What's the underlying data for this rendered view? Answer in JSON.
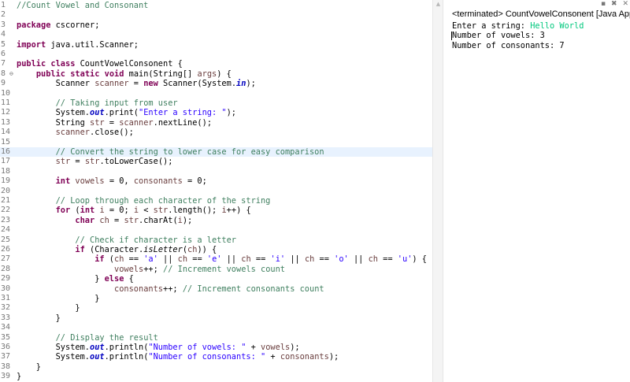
{
  "editor": {
    "lines": [
      {
        "n": "1",
        "tokens": [
          [
            "c",
            "//Count Vowel and Consonant"
          ]
        ]
      },
      {
        "n": "2",
        "tokens": []
      },
      {
        "n": "3",
        "tokens": [
          [
            "k",
            "package"
          ],
          [
            "p",
            " cscorner;"
          ]
        ]
      },
      {
        "n": "4",
        "tokens": []
      },
      {
        "n": "5",
        "tokens": [
          [
            "k",
            "import"
          ],
          [
            "p",
            " java.util.Scanner;"
          ]
        ]
      },
      {
        "n": "6",
        "tokens": []
      },
      {
        "n": "7",
        "tokens": [
          [
            "k",
            "public"
          ],
          [
            "p",
            " "
          ],
          [
            "k",
            "class"
          ],
          [
            "p",
            " CountVowelConsonent {"
          ]
        ]
      },
      {
        "n": "8",
        "fold": true,
        "tokens": [
          [
            "p",
            "    "
          ],
          [
            "k",
            "public"
          ],
          [
            "p",
            " "
          ],
          [
            "k",
            "static"
          ],
          [
            "p",
            " "
          ],
          [
            "k",
            "void"
          ],
          [
            "p",
            " main(String[] "
          ],
          [
            "v",
            "args"
          ],
          [
            "p",
            ") {"
          ]
        ]
      },
      {
        "n": "9",
        "tokens": [
          [
            "p",
            "        Scanner "
          ],
          [
            "v",
            "scanner"
          ],
          [
            "p",
            " = "
          ],
          [
            "k",
            "new"
          ],
          [
            "p",
            " Scanner(System."
          ],
          [
            "f",
            "in"
          ],
          [
            "p",
            ");"
          ]
        ]
      },
      {
        "n": "10",
        "tokens": []
      },
      {
        "n": "11",
        "tokens": [
          [
            "p",
            "        "
          ],
          [
            "c",
            "// Taking input from user"
          ]
        ]
      },
      {
        "n": "12",
        "tokens": [
          [
            "p",
            "        System."
          ],
          [
            "f",
            "out"
          ],
          [
            "p",
            ".print("
          ],
          [
            "s",
            "\"Enter a string: \""
          ],
          [
            "p",
            ");"
          ]
        ]
      },
      {
        "n": "13",
        "tokens": [
          [
            "p",
            "        String "
          ],
          [
            "v",
            "str"
          ],
          [
            "p",
            " = "
          ],
          [
            "v",
            "scanner"
          ],
          [
            "p",
            ".nextLine();"
          ]
        ]
      },
      {
        "n": "14",
        "tokens": [
          [
            "p",
            "        "
          ],
          [
            "v",
            "scanner"
          ],
          [
            "p",
            ".close();"
          ]
        ]
      },
      {
        "n": "15",
        "tokens": []
      },
      {
        "n": "16",
        "hl": true,
        "tokens": [
          [
            "p",
            "        "
          ],
          [
            "c",
            "// Convert the string to lower case for easy comparison"
          ]
        ]
      },
      {
        "n": "17",
        "tokens": [
          [
            "p",
            "        "
          ],
          [
            "v",
            "str"
          ],
          [
            "p",
            " = "
          ],
          [
            "v",
            "str"
          ],
          [
            "p",
            ".toLowerCase();"
          ]
        ]
      },
      {
        "n": "18",
        "tokens": []
      },
      {
        "n": "19",
        "tokens": [
          [
            "p",
            "        "
          ],
          [
            "k",
            "int"
          ],
          [
            "p",
            " "
          ],
          [
            "v",
            "vowels"
          ],
          [
            "p",
            " = 0, "
          ],
          [
            "v",
            "consonants"
          ],
          [
            "p",
            " = 0;"
          ]
        ]
      },
      {
        "n": "20",
        "tokens": []
      },
      {
        "n": "21",
        "tokens": [
          [
            "p",
            "        "
          ],
          [
            "c",
            "// Loop through each character of the string"
          ]
        ]
      },
      {
        "n": "22",
        "tokens": [
          [
            "p",
            "        "
          ],
          [
            "k",
            "for"
          ],
          [
            "p",
            " ("
          ],
          [
            "k",
            "int"
          ],
          [
            "p",
            " "
          ],
          [
            "v",
            "i"
          ],
          [
            "p",
            " = 0; "
          ],
          [
            "v",
            "i"
          ],
          [
            "p",
            " < "
          ],
          [
            "v",
            "str"
          ],
          [
            "p",
            ".length(); "
          ],
          [
            "v",
            "i"
          ],
          [
            "p",
            "++) {"
          ]
        ]
      },
      {
        "n": "23",
        "tokens": [
          [
            "p",
            "            "
          ],
          [
            "k",
            "char"
          ],
          [
            "p",
            " "
          ],
          [
            "v",
            "ch"
          ],
          [
            "p",
            " = "
          ],
          [
            "v",
            "str"
          ],
          [
            "p",
            ".charAt("
          ],
          [
            "v",
            "i"
          ],
          [
            "p",
            ");"
          ]
        ]
      },
      {
        "n": "24",
        "tokens": []
      },
      {
        "n": "25",
        "tokens": [
          [
            "p",
            "            "
          ],
          [
            "c",
            "// Check if character is a letter"
          ]
        ]
      },
      {
        "n": "26",
        "tokens": [
          [
            "p",
            "            "
          ],
          [
            "k",
            "if"
          ],
          [
            "p",
            " (Character."
          ],
          [
            "i",
            "isLetter"
          ],
          [
            "p",
            "("
          ],
          [
            "v",
            "ch"
          ],
          [
            "p",
            ")) {"
          ]
        ]
      },
      {
        "n": "27",
        "tokens": [
          [
            "p",
            "                "
          ],
          [
            "k",
            "if"
          ],
          [
            "p",
            " ("
          ],
          [
            "v",
            "ch"
          ],
          [
            "p",
            " == "
          ],
          [
            "s",
            "'a'"
          ],
          [
            "p",
            " || "
          ],
          [
            "v",
            "ch"
          ],
          [
            "p",
            " == "
          ],
          [
            "s",
            "'e'"
          ],
          [
            "p",
            " || "
          ],
          [
            "v",
            "ch"
          ],
          [
            "p",
            " == "
          ],
          [
            "s",
            "'i'"
          ],
          [
            "p",
            " || "
          ],
          [
            "v",
            "ch"
          ],
          [
            "p",
            " == "
          ],
          [
            "s",
            "'o'"
          ],
          [
            "p",
            " || "
          ],
          [
            "v",
            "ch"
          ],
          [
            "p",
            " == "
          ],
          [
            "s",
            "'u'"
          ],
          [
            "p",
            ") {"
          ]
        ]
      },
      {
        "n": "28",
        "tokens": [
          [
            "p",
            "                    "
          ],
          [
            "v",
            "vowels"
          ],
          [
            "p",
            "++; "
          ],
          [
            "c",
            "// Increment vowels count"
          ]
        ]
      },
      {
        "n": "29",
        "tokens": [
          [
            "p",
            "                } "
          ],
          [
            "k",
            "else"
          ],
          [
            "p",
            " {"
          ]
        ]
      },
      {
        "n": "30",
        "tokens": [
          [
            "p",
            "                    "
          ],
          [
            "v",
            "consonants"
          ],
          [
            "p",
            "++; "
          ],
          [
            "c",
            "// Increment consonants count"
          ]
        ]
      },
      {
        "n": "31",
        "tokens": [
          [
            "p",
            "                }"
          ]
        ]
      },
      {
        "n": "32",
        "tokens": [
          [
            "p",
            "            }"
          ]
        ]
      },
      {
        "n": "33",
        "tokens": [
          [
            "p",
            "        }"
          ]
        ]
      },
      {
        "n": "34",
        "tokens": []
      },
      {
        "n": "35",
        "tokens": [
          [
            "p",
            "        "
          ],
          [
            "c",
            "// Display the result"
          ]
        ]
      },
      {
        "n": "36",
        "tokens": [
          [
            "p",
            "        System."
          ],
          [
            "f",
            "out"
          ],
          [
            "p",
            ".println("
          ],
          [
            "s",
            "\"Number of vowels: \""
          ],
          [
            "p",
            " + "
          ],
          [
            "v",
            "vowels"
          ],
          [
            "p",
            ");"
          ]
        ]
      },
      {
        "n": "37",
        "tokens": [
          [
            "p",
            "        System."
          ],
          [
            "f",
            "out"
          ],
          [
            "p",
            ".println("
          ],
          [
            "s",
            "\"Number of consonants: \""
          ],
          [
            "p",
            " + "
          ],
          [
            "v",
            "consonants"
          ],
          [
            "p",
            ");"
          ]
        ]
      },
      {
        "n": "38",
        "tokens": [
          [
            "p",
            "    }"
          ]
        ]
      },
      {
        "n": "39",
        "tokens": [
          [
            "p",
            "}"
          ]
        ]
      }
    ]
  },
  "console": {
    "title": "<terminated> CountVowelConsonent [Java App",
    "lines": [
      {
        "out": "Enter a string: ",
        "in": "Hello World"
      },
      {
        "out": "Number of vowels: 3",
        "in": ""
      },
      {
        "out": "Number of consonants: 7",
        "in": ""
      }
    ],
    "toolbar_icons": [
      "minimize-icon",
      "remove-all-icon",
      "close-icon"
    ]
  },
  "colors": {
    "keyword": "#7f0055",
    "comment": "#3f7f5f",
    "string": "#2a00ff",
    "field": "#0000c0",
    "console_input": "#00c87d",
    "highlight_line": "#e8f2fe"
  }
}
